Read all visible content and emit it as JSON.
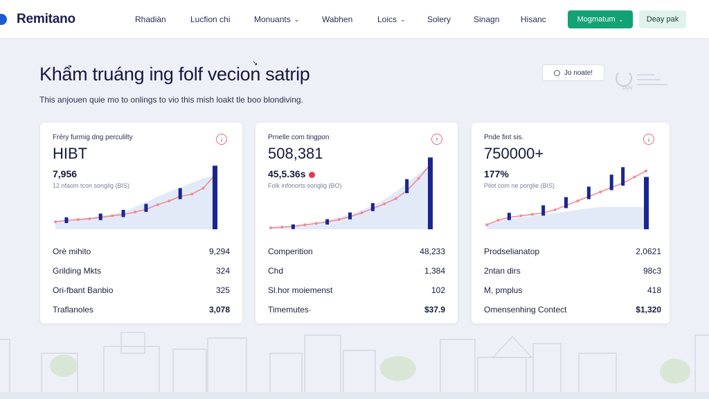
{
  "header": {
    "logo_text": "Remitano",
    "nav": [
      {
        "label": "Rhadiàn",
        "dropdown": false
      },
      {
        "label": "Lucfion chi",
        "dropdown": false
      },
      {
        "label": "Monuants",
        "dropdown": true
      },
      {
        "label": "Wabhen",
        "dropdown": false
      },
      {
        "label": "Loics",
        "dropdown": true
      },
      {
        "label": "Solery",
        "dropdown": false
      },
      {
        "label": "Sinagn",
        "dropdown": false
      },
      {
        "label": "Hisanc",
        "dropdown": false
      }
    ],
    "primary_button": "Mogmatum",
    "secondary_button": "Deay pak"
  },
  "hero": {
    "title": "Khẩm truáng ing folf vecion satrip",
    "title_mark": "↘",
    "subtitle": "This anjouen quie mo to onlings to vio this mish loakt tle boo blondiving.",
    "search_label": "Jo noate!",
    "loader_label": "DUV"
  },
  "cards": [
    {
      "label": "Fréry furmig dng perculilty",
      "value": "HIBT",
      "sub_value": "7,956",
      "sub_marker": "",
      "note": "12 nfaom tcon songlig (BIS)",
      "info_icon": "↓",
      "rows": [
        {
          "label": "Orè mihito",
          "value": "9,294"
        },
        {
          "label": "Grilding Mkts",
          "value": "324"
        },
        {
          "label": "Ori-fbant Banbio",
          "value": "325"
        },
        {
          "label": "Traflanoles",
          "value": "3,078"
        }
      ]
    },
    {
      "label": "Prnelle com tingpon",
      "value": "508,381",
      "sub_value": "45,5.36s",
      "sub_marker": "dot",
      "note": "Folk infonorts songlig (BO)",
      "info_icon": "↑",
      "rows": [
        {
          "label": "Comperition",
          "value": "48,233"
        },
        {
          "label": "Chd",
          "value": "1,384"
        },
        {
          "label": "Sl.hor moiemenst",
          "value": "102"
        },
        {
          "label": "Timemutes·",
          "value": "$37.9"
        }
      ]
    },
    {
      "label": "Pnde fint sis.",
      "value": "750000+",
      "sub_value": "177%",
      "sub_marker": "",
      "note": "Pilot com ne porglie (BIS)",
      "info_icon": "↓",
      "rows": [
        {
          "label": "Prodselianatop",
          "value": "2,0621"
        },
        {
          "label": "2ntan dirs",
          "value": "98c3"
        },
        {
          "label": "M, pmplus",
          "value": "418"
        },
        {
          "label": "Omensenhing Contect",
          "value": "$1,320"
        }
      ]
    }
  ],
  "chart_data": [
    {
      "type": "line",
      "x": [
        0,
        1,
        2,
        3,
        4,
        5,
        6,
        7,
        8,
        9,
        10,
        11,
        12,
        13,
        14
      ],
      "line": [
        10,
        12,
        13,
        14,
        16,
        18,
        20,
        23,
        27,
        33,
        38,
        44,
        47,
        55,
        72
      ],
      "area": [
        10,
        12,
        14,
        16,
        18,
        20,
        24,
        30,
        36,
        44,
        50,
        56,
        62,
        68,
        72
      ],
      "bars": [
        {
          "x": 1,
          "v": 8
        },
        {
          "x": 4,
          "v": 10
        },
        {
          "x": 6,
          "v": 12
        },
        {
          "x": 8,
          "v": 14
        },
        {
          "x": 11,
          "v": 22
        },
        {
          "x": 14,
          "v": 85
        }
      ],
      "ylim": [
        0,
        100
      ]
    },
    {
      "type": "line",
      "x": [
        0,
        1,
        2,
        3,
        4,
        5,
        6,
        7,
        8,
        9,
        10,
        11,
        12,
        13,
        14
      ],
      "line": [
        2,
        3,
        4,
        6,
        8,
        10,
        13,
        17,
        22,
        28,
        34,
        41,
        52,
        68,
        86
      ],
      "area": [
        2,
        3,
        4,
        6,
        8,
        12,
        16,
        20,
        26,
        32,
        40,
        50,
        62,
        74,
        86
      ],
      "bars": [
        {
          "x": 2,
          "v": 5
        },
        {
          "x": 5,
          "v": 7
        },
        {
          "x": 7,
          "v": 11
        },
        {
          "x": 9,
          "v": 14
        },
        {
          "x": 12,
          "v": 30
        },
        {
          "x": 14,
          "v": 96
        }
      ],
      "ylim": [
        0,
        100
      ]
    },
    {
      "type": "line",
      "x": [
        0,
        1,
        2,
        3,
        4,
        5,
        6,
        7,
        8,
        9,
        10,
        11,
        12,
        13,
        14
      ],
      "line": [
        6,
        12,
        16,
        18,
        20,
        22,
        26,
        32,
        38,
        44,
        50,
        56,
        62,
        70,
        78
      ],
      "area": [
        6,
        10,
        14,
        16,
        18,
        20,
        22,
        24,
        26,
        28,
        30,
        30,
        30,
        30,
        30
      ],
      "bars": [
        {
          "x": 2,
          "v": 12
        },
        {
          "x": 5,
          "v": 20
        },
        {
          "x": 7,
          "v": 22
        },
        {
          "x": 9,
          "v": 26
        },
        {
          "x": 11,
          "v": 34
        },
        {
          "x": 12,
          "v": 42
        },
        {
          "x": 14,
          "v": 70
        }
      ],
      "ylim": [
        0,
        100
      ]
    }
  ],
  "colors": {
    "accent_green": "#12a276",
    "brand_blue": "#1e5ad6",
    "line_red": "#f08a94",
    "bar_navy": "#1a2690",
    "area_fill": "#e2eaf8"
  }
}
